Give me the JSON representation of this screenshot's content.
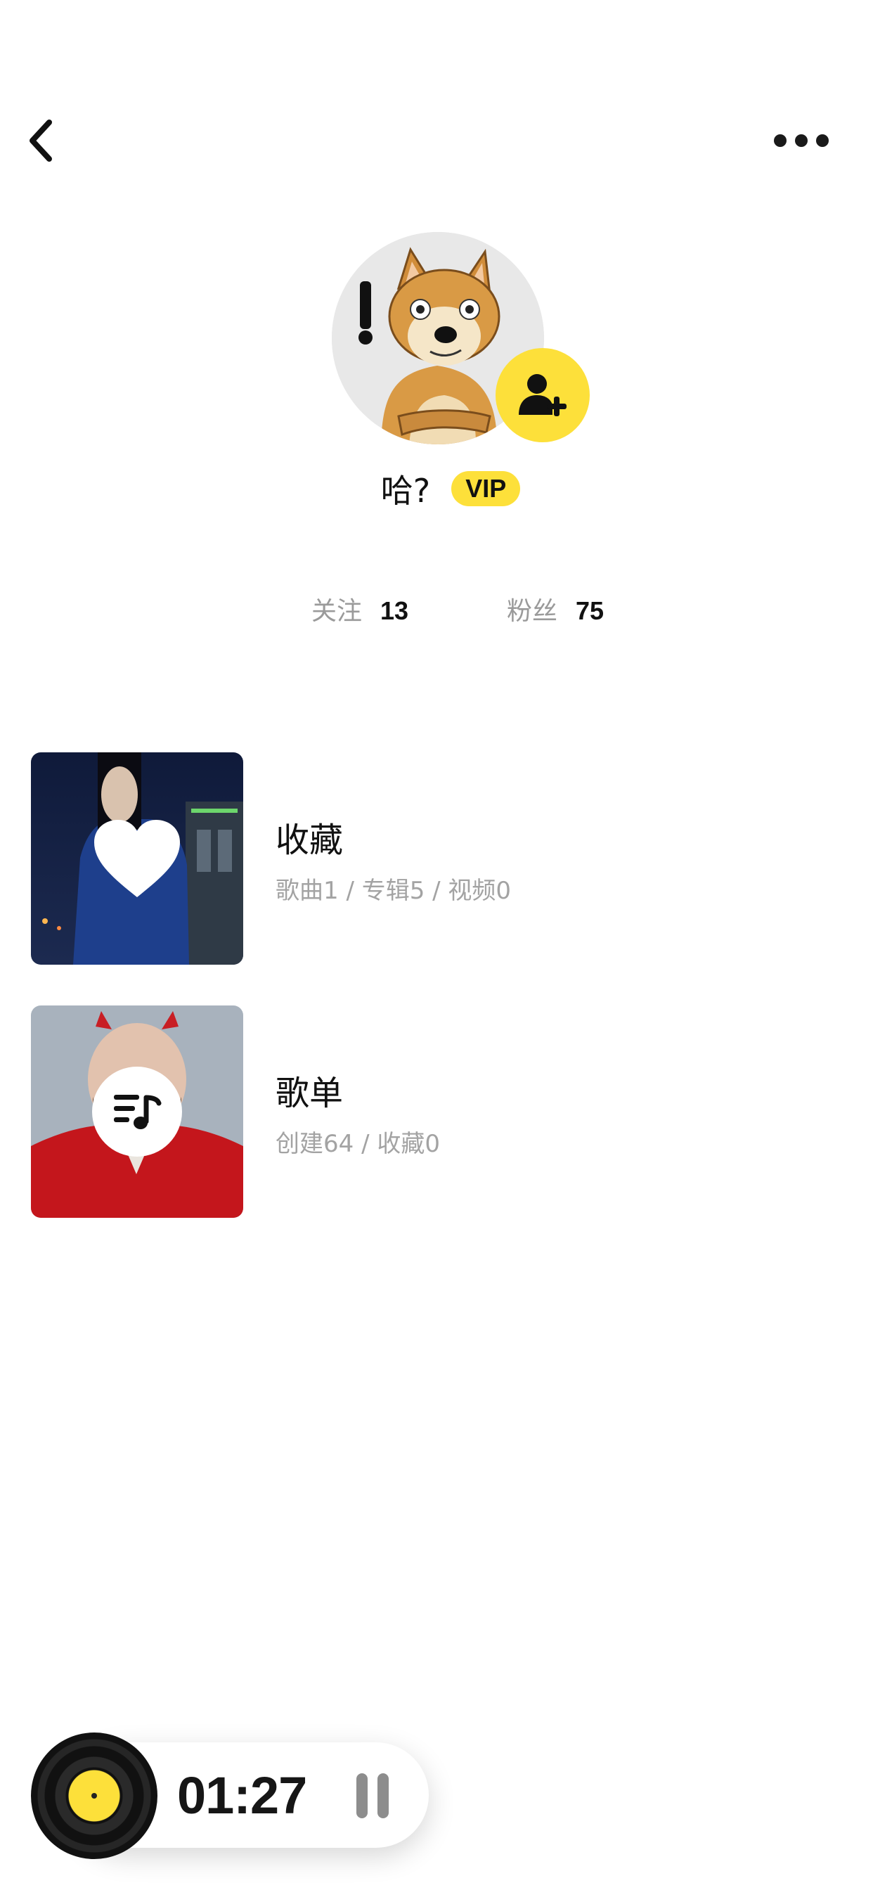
{
  "header": {
    "back_icon": "chevron-left-icon",
    "more_icon": "more-horizontal-icon"
  },
  "profile": {
    "avatar": "shiba-dog-avatar",
    "follow_icon": "add-user-icon",
    "nickname": "哈?",
    "vip_label": "VIP",
    "accent_color": "#fde03a"
  },
  "stats": [
    {
      "label": "关注",
      "value": "13"
    },
    {
      "label": "粉丝",
      "value": "75"
    }
  ],
  "library": [
    {
      "title": "收藏",
      "subtitle": "歌曲1 / 专辑5 / 视频0",
      "icon": "heart-icon"
    },
    {
      "title": "歌单",
      "subtitle": "创建64 / 收藏0",
      "icon": "playlist-icon"
    }
  ],
  "player": {
    "time": "01:27",
    "disc_icon": "vinyl-disc-icon",
    "pause_icon": "pause-icon"
  }
}
